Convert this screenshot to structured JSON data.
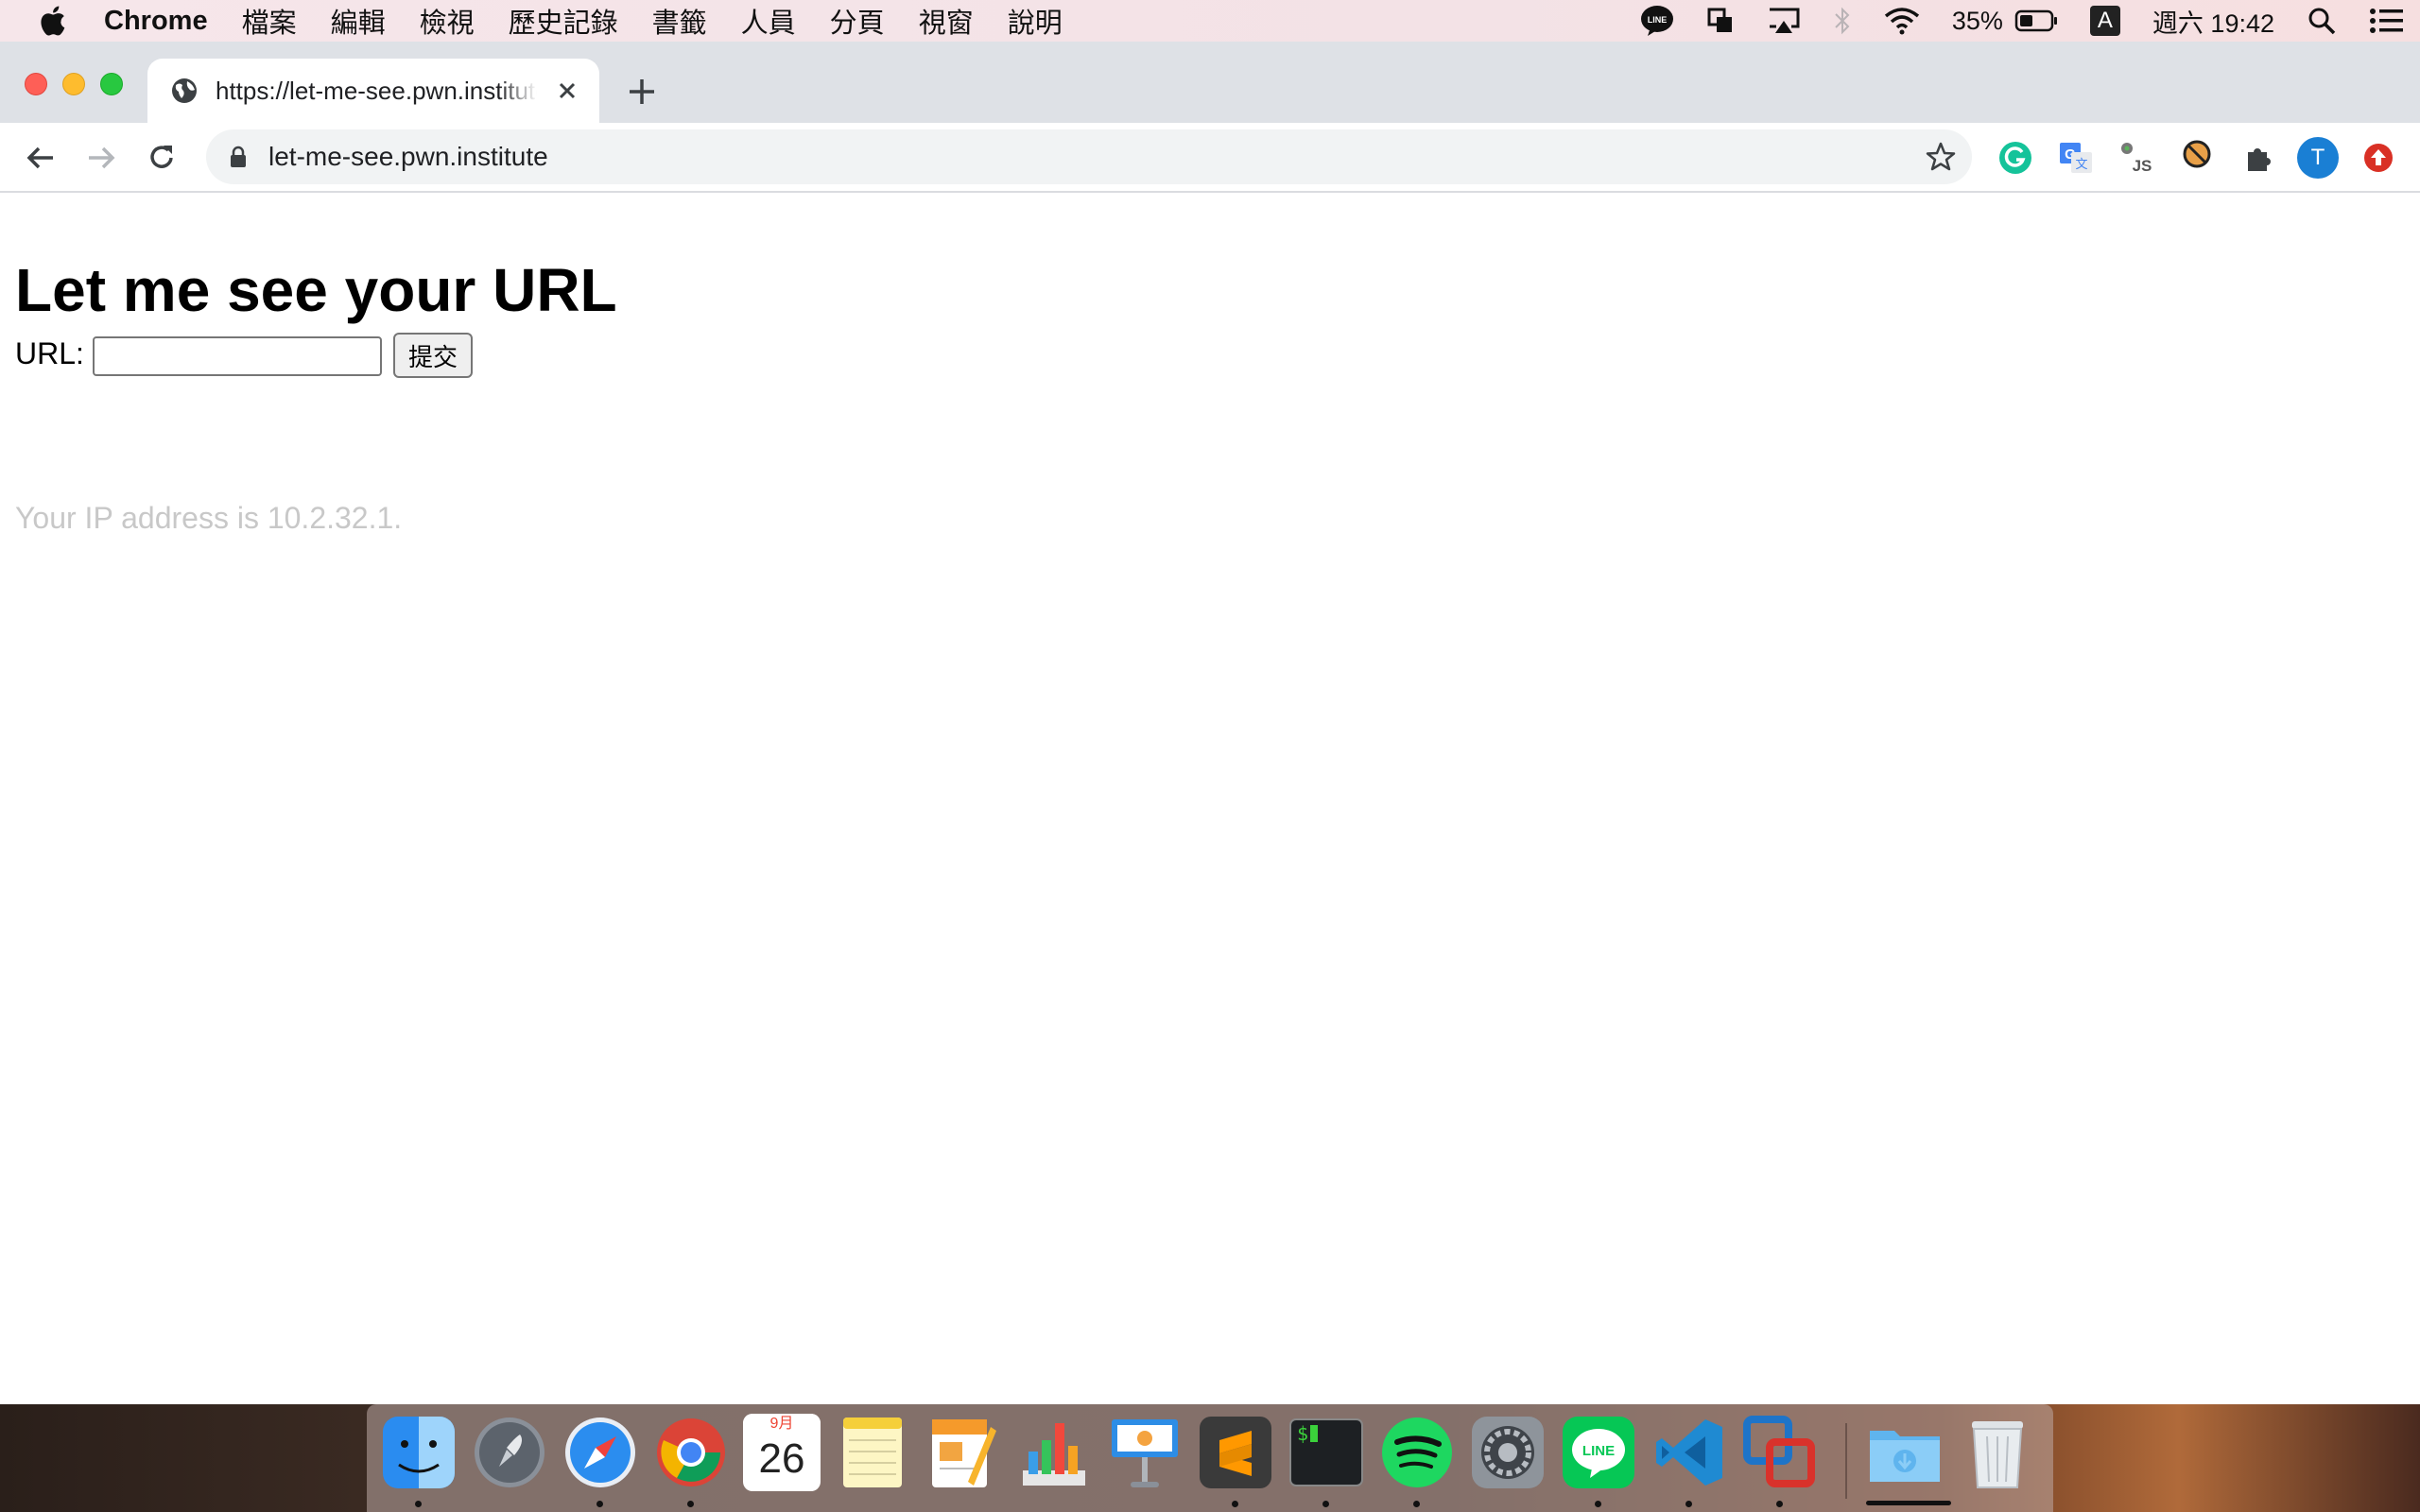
{
  "menubar": {
    "app_name": "Chrome",
    "menus": [
      "檔案",
      "編輯",
      "檢視",
      "歷史記錄",
      "書籤",
      "人員",
      "分頁",
      "視窗",
      "說明"
    ],
    "battery": "35%",
    "input_method": "A",
    "clock": "週六 19:42"
  },
  "browser": {
    "tab_title": "https://let-me-see.pwn.institute",
    "address": "let-me-see.pwn.institute",
    "profile_initial": "T"
  },
  "page": {
    "heading": "Let me see your URL",
    "url_label": "URL:",
    "url_value": "",
    "submit_label": "提交",
    "ip_text": "Your IP address is 10.2.32.1."
  },
  "dock": {
    "calendar_month": "9月",
    "calendar_day": "26",
    "apps": [
      "Finder",
      "Launchpad",
      "Safari",
      "Chrome",
      "Calendar",
      "Notes",
      "Pages",
      "Numbers",
      "Keynote",
      "Sublime Text",
      "Terminal",
      "Spotify",
      "System Preferences",
      "LINE",
      "Visual Studio Code",
      "VMware Fusion",
      "Downloads",
      "Trash"
    ]
  },
  "colors": {
    "ip_text": "#c8c8c8",
    "tabstrip": "#dee1e6",
    "omnibox": "#f1f3f4"
  }
}
